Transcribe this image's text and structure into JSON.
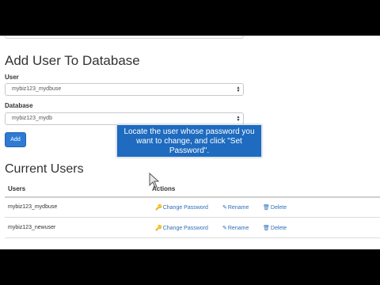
{
  "add_form": {
    "heading": "Add User To Database",
    "user_label": "User",
    "user_value": "mybiz123_mydbuse",
    "db_label": "Database",
    "db_value": "mybiz123_mydb",
    "add_label": "Add"
  },
  "tooltip": {
    "text": "Locate the user whose password you want to change, and click \"Set Password\"."
  },
  "current_users": {
    "heading": "Current Users",
    "columns": [
      "Users",
      "Actions"
    ],
    "rows": [
      {
        "user": "mybiz123_mydbuse",
        "actions": {
          "change_password": "Change Password",
          "rename": "Rename",
          "delete": "Delete"
        }
      },
      {
        "user": "mybiz123_newuser",
        "actions": {
          "change_password": "Change Password",
          "rename": "Rename",
          "delete": "Delete"
        }
      }
    ]
  },
  "icons": {
    "key": "key-icon",
    "pencil": "pencil-icon",
    "trash": "trash-icon",
    "caret": "select-caret-icon",
    "cursor": "mouse-cursor-icon"
  },
  "colors": {
    "accent": "#2d7bd4",
    "link": "#2d6fb7",
    "tooltip": "#1e6bbf"
  }
}
